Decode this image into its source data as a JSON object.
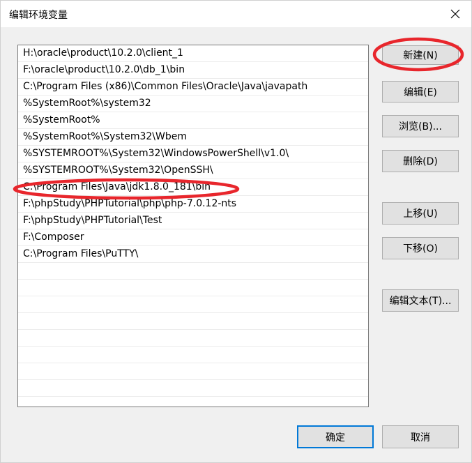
{
  "window": {
    "title": "编辑环境变量"
  },
  "paths": [
    "H:\\oracle\\product\\10.2.0\\client_1",
    "F:\\oracle\\product\\10.2.0\\db_1\\bin",
    "C:\\Program Files (x86)\\Common Files\\Oracle\\Java\\javapath",
    "%SystemRoot%\\system32",
    "%SystemRoot%",
    "%SystemRoot%\\System32\\Wbem",
    "%SYSTEMROOT%\\System32\\WindowsPowerShell\\v1.0\\",
    "%SYSTEMROOT%\\System32\\OpenSSH\\",
    "C:\\Program Files\\Java\\jdk1.8.0_181\\bin",
    "F:\\phpStudy\\PHPTutorial\\php\\php-7.0.12-nts",
    "F:\\phpStudy\\PHPTutorial\\Test",
    "F:\\Composer",
    "C:\\Program Files\\PuTTY\\"
  ],
  "empty_rows": 9,
  "buttons": {
    "new": "新建(N)",
    "edit": "编辑(E)",
    "browse": "浏览(B)...",
    "delete": "删除(D)",
    "move_up": "上移(U)",
    "move_down": "下移(O)",
    "edit_text": "编辑文本(T)...",
    "ok": "确定",
    "cancel": "取消"
  },
  "annotation_color": "#e8262c",
  "accent_color": "#0078d7"
}
